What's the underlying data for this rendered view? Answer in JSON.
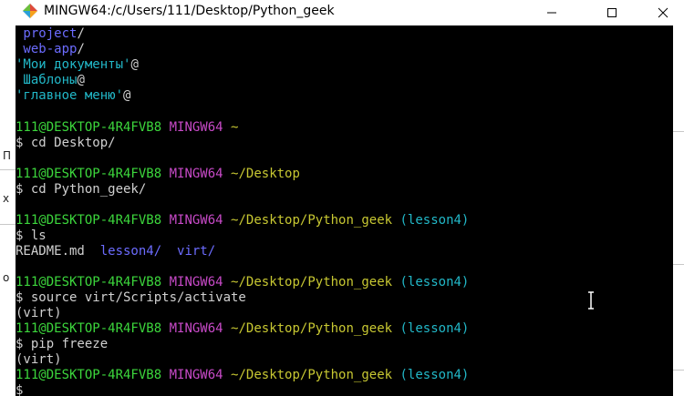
{
  "window": {
    "title": "MINGW64:/c/Users/111/Desktop/Python_geek",
    "min_glyph": "—",
    "max_glyph": "☐",
    "close_glyph": "✕"
  },
  "colors": {
    "dir_blue": "#6c6cff",
    "prompt_green": "#3cd63c",
    "mingw_magenta": "#c84ac8",
    "path_yellow": "#c8c832",
    "branch_cyan": "#22b8c8",
    "text": "#d0d0d0"
  },
  "background_window": {
    "chars": [
      "П",
      "х",
      "о"
    ]
  },
  "terminal": {
    "listing": [
      {
        "text": " project",
        "suffix": "/"
      },
      {
        "text": " web-app",
        "suffix": "/"
      },
      {
        "text": "'Мои документы'",
        "suffix": "@"
      },
      {
        "text": " Шаблоны",
        "suffix": "@"
      },
      {
        "text": "'главное меню'",
        "suffix": "@"
      }
    ],
    "prompt_user": "111@DESKTOP-4R4FVB8",
    "prompt_system": "MINGW64",
    "prompts": [
      {
        "path": "~",
        "branch": ""
      },
      {
        "path": "~/Desktop",
        "branch": ""
      },
      {
        "path": "~/Desktop/Python_geek",
        "branch": "(lesson4)"
      },
      {
        "path": "~/Desktop/Python_geek",
        "branch": "(lesson4)"
      },
      {
        "path": "~/Desktop/Python_geek",
        "branch": "(lesson4)"
      },
      {
        "path": "~/Desktop/Python_geek",
        "branch": "(lesson4)"
      }
    ],
    "commands": [
      "$ cd Desktop/",
      "$ cd Python_geek/",
      "$ ls",
      "$ source virt/Scripts/activate",
      "$ pip freeze",
      "$"
    ],
    "ls_output": {
      "file": "README.md",
      "dirs": [
        "lesson4/",
        "virt/"
      ]
    },
    "venv_label": "(virt)"
  }
}
